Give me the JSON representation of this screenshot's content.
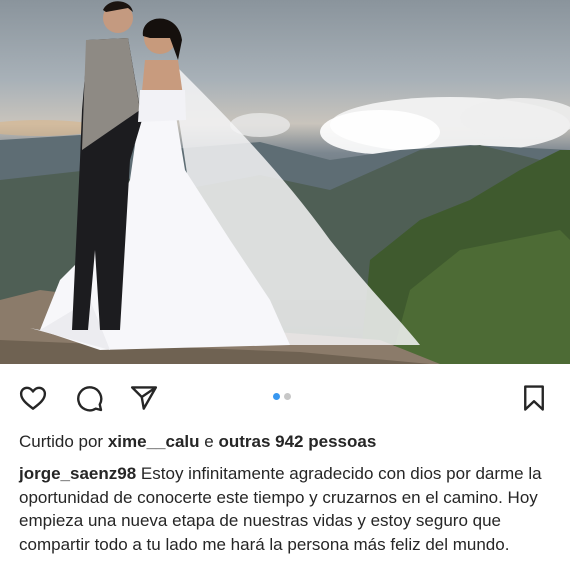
{
  "post": {
    "photo_description_icon": "wedding-photo",
    "carousel": {
      "count": 2,
      "active": 1
    },
    "likes": {
      "prefix": "Curtido por",
      "user": "xime__calu",
      "connector": "e",
      "others": "outras 942 pessoas"
    },
    "caption": {
      "username": "jorge_saenz98",
      "text": "Estoy infinitamente agradecido con dios por darme la oportunidad de conocerte este tiempo y cruzarnos en el camino. Hoy empieza una nueva etapa de nuestras vidas y estoy seguro que compartir todo a tu lado me hará la persona más feliz del mundo."
    }
  },
  "icons": {
    "like": "heart-icon",
    "comment": "comment-icon",
    "share": "send-icon",
    "save": "bookmark-icon"
  },
  "colors": {
    "text": "#262626",
    "carousel_active": "#3897f0",
    "carousel_inactive": "#c7c7c7"
  }
}
